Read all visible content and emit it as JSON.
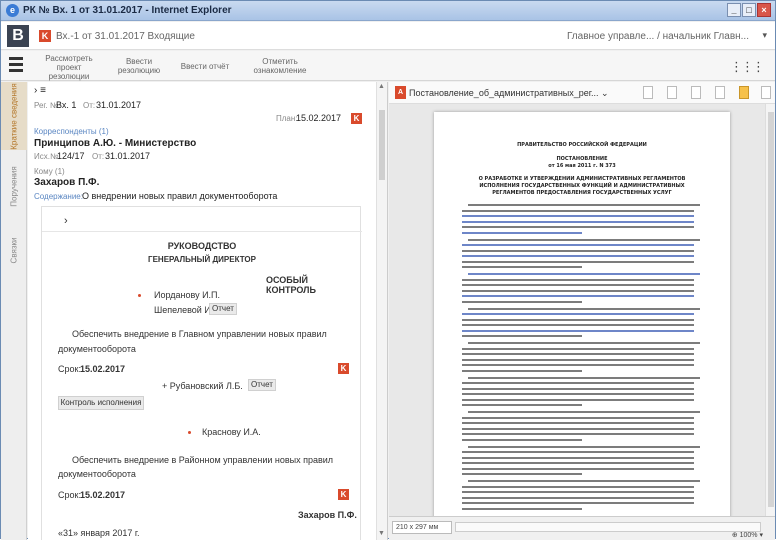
{
  "window": {
    "title": "РК № Вх. 1 от 31.01.2017 - Internet Explorer",
    "min": "_",
    "max": "□",
    "close": "×"
  },
  "header": {
    "logo": "B",
    "badge": "K",
    "doc_title": "Вх.-1 от 31.01.2017 Входящие",
    "user": "Главное управле... / начальник Главн...",
    "chevron": "▾"
  },
  "toolbar": {
    "buttons": [
      {
        "line1": "Рассмотреть",
        "line2": "проект",
        "line3": "резолюции"
      },
      {
        "line1": "Ввести",
        "line2": "резолюцию",
        "line3": ""
      },
      {
        "line1": "Ввести отчёт",
        "line2": "",
        "line3": ""
      },
      {
        "line1": "Отметить",
        "line2": "ознакомление",
        "line3": ""
      }
    ],
    "grid_icon": "⋮⋮⋮",
    "chevron": "⌄"
  },
  "side_tabs": [
    "Краткие сведения",
    "Поручения",
    "Связки"
  ],
  "left": {
    "nav": "› ≡",
    "reg_label": "Рег. №:",
    "reg_num": "Вх. 1",
    "reg_date_label": "От:",
    "reg_date": "31.01.2017",
    "plan_label": "План:",
    "plan_date": "15.02.2017",
    "corr_label": "Корреспонденты (1)",
    "corr_name": "Принципов А.Ю. - Министерство",
    "out_label": "Исх.№:",
    "out_num": "124/17",
    "out_date_label": "От:",
    "out_date": "31.01.2017",
    "to_label": "Кому (1)",
    "to_name": "Захаров П.Ф.",
    "content_label": "Содержание:",
    "content": "О внедрении новых правил документооборота",
    "card": {
      "arrow": "›",
      "head1": "РУКОВОДСТВО",
      "head2": "ГЕНЕРАЛЬНЫЙ ДИРЕКТОР",
      "special": "ОСОБЫЙ КОНТРОЛЬ",
      "exec1": "Иорданову И.П.",
      "exec1b": "Шепелевой И.Г.",
      "report_btn": "Отчет",
      "task1a": "Обеспечить внедрение в Главном управлении новых правил",
      "task1b": "документооборота",
      "term_label": "Срок:",
      "term1": "15.02.2017",
      "co_exec": "+ Рубановский Л.Б.",
      "report_btn2": "Отчет",
      "control_btn": "Контроль исполнения",
      "exec2": "Краснову И.А.",
      "task2a": "Обеспечить внедрение в Районном управлении новых правил",
      "task2b": "документооборота",
      "term2": "15.02.2017",
      "signer": "Захаров П.Ф.",
      "date_sign": "«31» января 2017 г."
    }
  },
  "right": {
    "file_name": "Постановление_об_административных_рег...",
    "chevron": "⌄",
    "page_title1": "ПРАВИТЕЛЬСТВО РОССИЙСКОЙ ФЕДЕРАЦИИ",
    "page_title2": "ПОСТАНОВЛЕНИЕ",
    "page_title3": "от 16 мая 2011 г. N 373",
    "page_head1": "О РАЗРАБОТКЕ И УТВЕРЖДЕНИИ АДМИНИСТРАТИВНЫХ РЕГЛАМЕНТОВ",
    "page_head2": "ИСПОЛНЕНИЯ ГОСУДАРСТВЕННЫХ ФУНКЦИЙ И АДМИНИСТРАТИВНЫХ",
    "page_head3": "РЕГЛАМЕНТОВ ПРЕДОСТАВЛЕНИЯ ГОСУДАРСТВЕННЫХ УСЛУГ",
    "size": "210 x 297 мм",
    "zoom": "⊕ 100%",
    "zoom_chevron": "▾"
  }
}
